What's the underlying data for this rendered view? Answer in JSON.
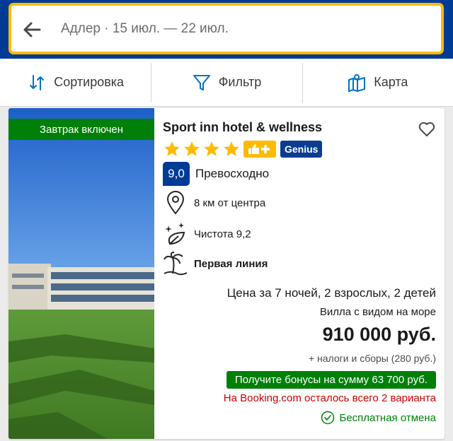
{
  "search": {
    "summary": "Адлер · 15 июл. — 22 июл."
  },
  "toolbar": {
    "sort_label": "Сортировка",
    "filter_label": "Фильтр",
    "map_label": "Карта"
  },
  "hotel": {
    "badge": "Завтрак включен",
    "name": "Sport inn hotel & wellness",
    "stars": 4,
    "genius_label": "Genius",
    "score": "9,0",
    "score_text": "Превосходно",
    "distance": "8 км от центра",
    "cleanliness": "Чистота 9,2",
    "beach": "Первая линия",
    "price_for": "Цена за 7 ночей, 2 взрослых, 2 детей",
    "room": "Вилла с видом на море",
    "price": "910 000 руб.",
    "taxes": "+ налоги и сборы (280 руб.)",
    "bonus": "Получите бонусы на сумму 63 700 руб.",
    "availability": "На Booking.com осталось всего 2 варианта",
    "cancellation": "Бесплатная отмена"
  },
  "colors": {
    "header_bg": "#003b95",
    "search_border": "#febb02",
    "green": "#008009",
    "red": "#cc0000",
    "star": "#febb02"
  }
}
